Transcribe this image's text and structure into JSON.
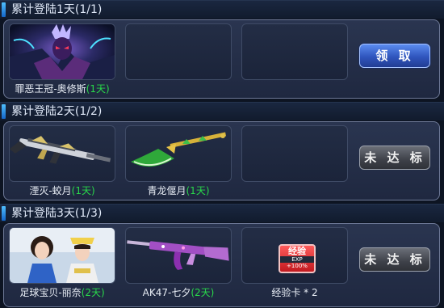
{
  "sections": [
    {
      "title": "累计登陆1天(1/1)",
      "button": "领 取",
      "items": [
        {
          "name": "罪恶王冠-奥修斯",
          "duration": "(1天)",
          "icon": "character-portrait-icon"
        },
        {
          "name": "",
          "duration": ""
        },
        {
          "name": "",
          "duration": ""
        }
      ]
    },
    {
      "title": "累计登陆2天(1/2)",
      "button": "未 达 标",
      "items": [
        {
          "name": "湮灭-蛟月",
          "duration": "(1天)",
          "icon": "rifle-weapon-icon"
        },
        {
          "name": "青龙偃月",
          "duration": "(1天)",
          "icon": "blade-weapon-icon"
        },
        {
          "name": "",
          "duration": ""
        }
      ]
    },
    {
      "title": "累计登陆3天(1/3)",
      "button": "未 达 标",
      "items": [
        {
          "name": "足球宝贝-丽奈",
          "duration": "(2天)",
          "icon": "character-pair-icon"
        },
        {
          "name": "AK47-七夕",
          "duration": "(2天)",
          "icon": "assault-rifle-icon"
        },
        {
          "name": "经验卡 * 2",
          "duration": "",
          "icon": "exp-card-icon",
          "card_text": "经验",
          "card_exp": "EXP",
          "card_bonus": "+100%"
        }
      ]
    }
  ],
  "colors": {
    "duration": "#29d84a",
    "claim_button": "#2f55bd",
    "disabled_button": "#3e4149",
    "accent_bar": "#4fc0ff"
  }
}
